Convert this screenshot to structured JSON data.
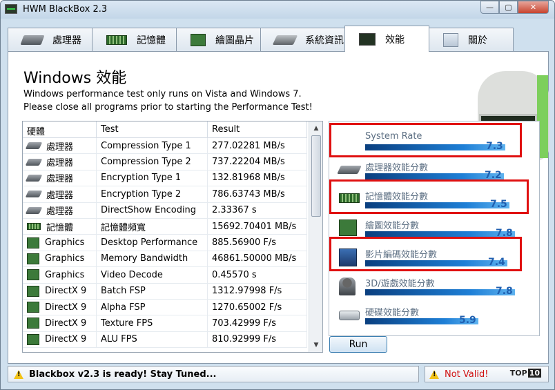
{
  "window": {
    "title": "HWM BlackBox 2.3"
  },
  "tabs": [
    {
      "label": "處理器",
      "icon": "cpu-icon"
    },
    {
      "label": "記憶體",
      "icon": "ram-icon"
    },
    {
      "label": "繪圖晶片",
      "icon": "gpu-icon"
    },
    {
      "label": "系統資訊",
      "icon": "system-icon"
    },
    {
      "label": "效能",
      "icon": "performance-icon",
      "active": true
    },
    {
      "label": "關於",
      "icon": "about-icon"
    }
  ],
  "page": {
    "title": "Windows 效能",
    "intro_line1": "Windows performance test only runs on Vista and Windows 7.",
    "intro_line2": "Please close all programs prior to starting the Performance Test!"
  },
  "table": {
    "headers": [
      "硬體",
      "Test",
      "Result"
    ],
    "rows": [
      {
        "hw": "處理器",
        "icon": "cpu",
        "test": "Compression Type 1",
        "result": "277.02281 MB/s"
      },
      {
        "hw": "處理器",
        "icon": "cpu",
        "test": "Compression Type 2",
        "result": "737.22204 MB/s"
      },
      {
        "hw": "處理器",
        "icon": "cpu",
        "test": "Encryption Type 1",
        "result": "132.81968 MB/s"
      },
      {
        "hw": "處理器",
        "icon": "cpu",
        "test": "Encryption Type 2",
        "result": "786.63743 MB/s"
      },
      {
        "hw": "處理器",
        "icon": "cpu",
        "test": "DirectShow Encoding",
        "result": "2.33367 s"
      },
      {
        "hw": "記憶體",
        "icon": "ram",
        "test": "記憶體頻寬",
        "result": "15692.70401 MB/s"
      },
      {
        "hw": "Graphics",
        "icon": "gpu",
        "test": "Desktop Performance",
        "result": "885.56900 F/s"
      },
      {
        "hw": "Graphics",
        "icon": "gpu",
        "test": "Memory Bandwidth",
        "result": "46861.50000 MB/s"
      },
      {
        "hw": "Graphics",
        "icon": "gpu",
        "test": "Video Decode",
        "result": "0.45570 s"
      },
      {
        "hw": "DirectX 9",
        "icon": "gpu",
        "test": "Batch FSP",
        "result": "1312.97998 F/s"
      },
      {
        "hw": "DirectX 9",
        "icon": "gpu",
        "test": "Alpha FSP",
        "result": "1270.65002 F/s"
      },
      {
        "hw": "DirectX 9",
        "icon": "gpu",
        "test": "Texture FPS",
        "result": "703.42999 F/s"
      },
      {
        "hw": "DirectX 9",
        "icon": "gpu",
        "test": "ALU FPS",
        "result": "810.92999 F/s"
      }
    ]
  },
  "ratings": [
    {
      "label": "System Rate",
      "value": "7.3",
      "icon": "system"
    },
    {
      "label": "處理器效能分數",
      "value": "7.2",
      "icon": "cpu"
    },
    {
      "label": "記憶體效能分數",
      "value": "7.5",
      "icon": "ram"
    },
    {
      "label": "繪圖效能分數",
      "value": "7.8",
      "icon": "gpu"
    },
    {
      "label": "影片編碼效能分數",
      "value": "7.4",
      "icon": "video"
    },
    {
      "label": "3D/遊戲效能分數",
      "value": "7.8",
      "icon": "game"
    },
    {
      "label": "硬碟效能分數",
      "value": "5.9",
      "icon": "disk"
    }
  ],
  "run_button": "Run",
  "status": {
    "message": "Blackbox v2.3 is ready! Stay Tuned...",
    "validity": "Not Valid!",
    "logo_text": "TOP",
    "logo_num": "10"
  },
  "colors": {
    "highlight": "#e01010",
    "rating_value": "#1f5fb0",
    "bar": "#1e7fd6"
  }
}
